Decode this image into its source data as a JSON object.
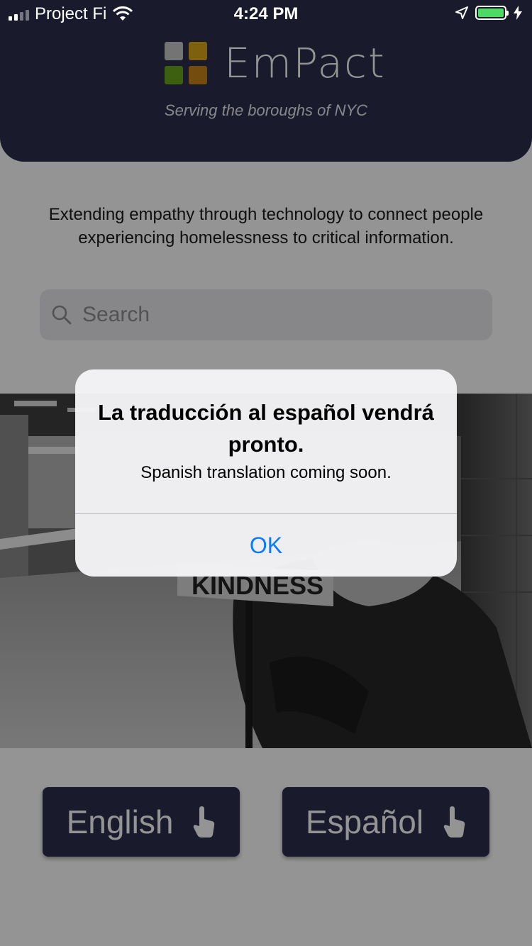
{
  "status_bar": {
    "carrier": "Project Fi",
    "time": "4:24 PM"
  },
  "header": {
    "brand": "EmPact",
    "tagline": "Serving the boroughs of NYC",
    "logo_colors": [
      "#c8c8c8",
      "#d9a61a",
      "#6aa51c",
      "#c88417"
    ]
  },
  "mission": "Extending empathy through technology to connect people experiencing homelessness to critical information.",
  "search": {
    "placeholder": "Search",
    "value": ""
  },
  "photo": {
    "sign_text": "KINDNESS"
  },
  "language_buttons": {
    "english": "English",
    "spanish": "Español"
  },
  "alert": {
    "title": "La traducción al español vendrá pronto.",
    "message": "Spanish translation coming soon.",
    "ok": "OK"
  },
  "colors": {
    "header_bg": "#2b2f4e",
    "alert_button": "#0a7aff",
    "battery": "#4cd964"
  }
}
